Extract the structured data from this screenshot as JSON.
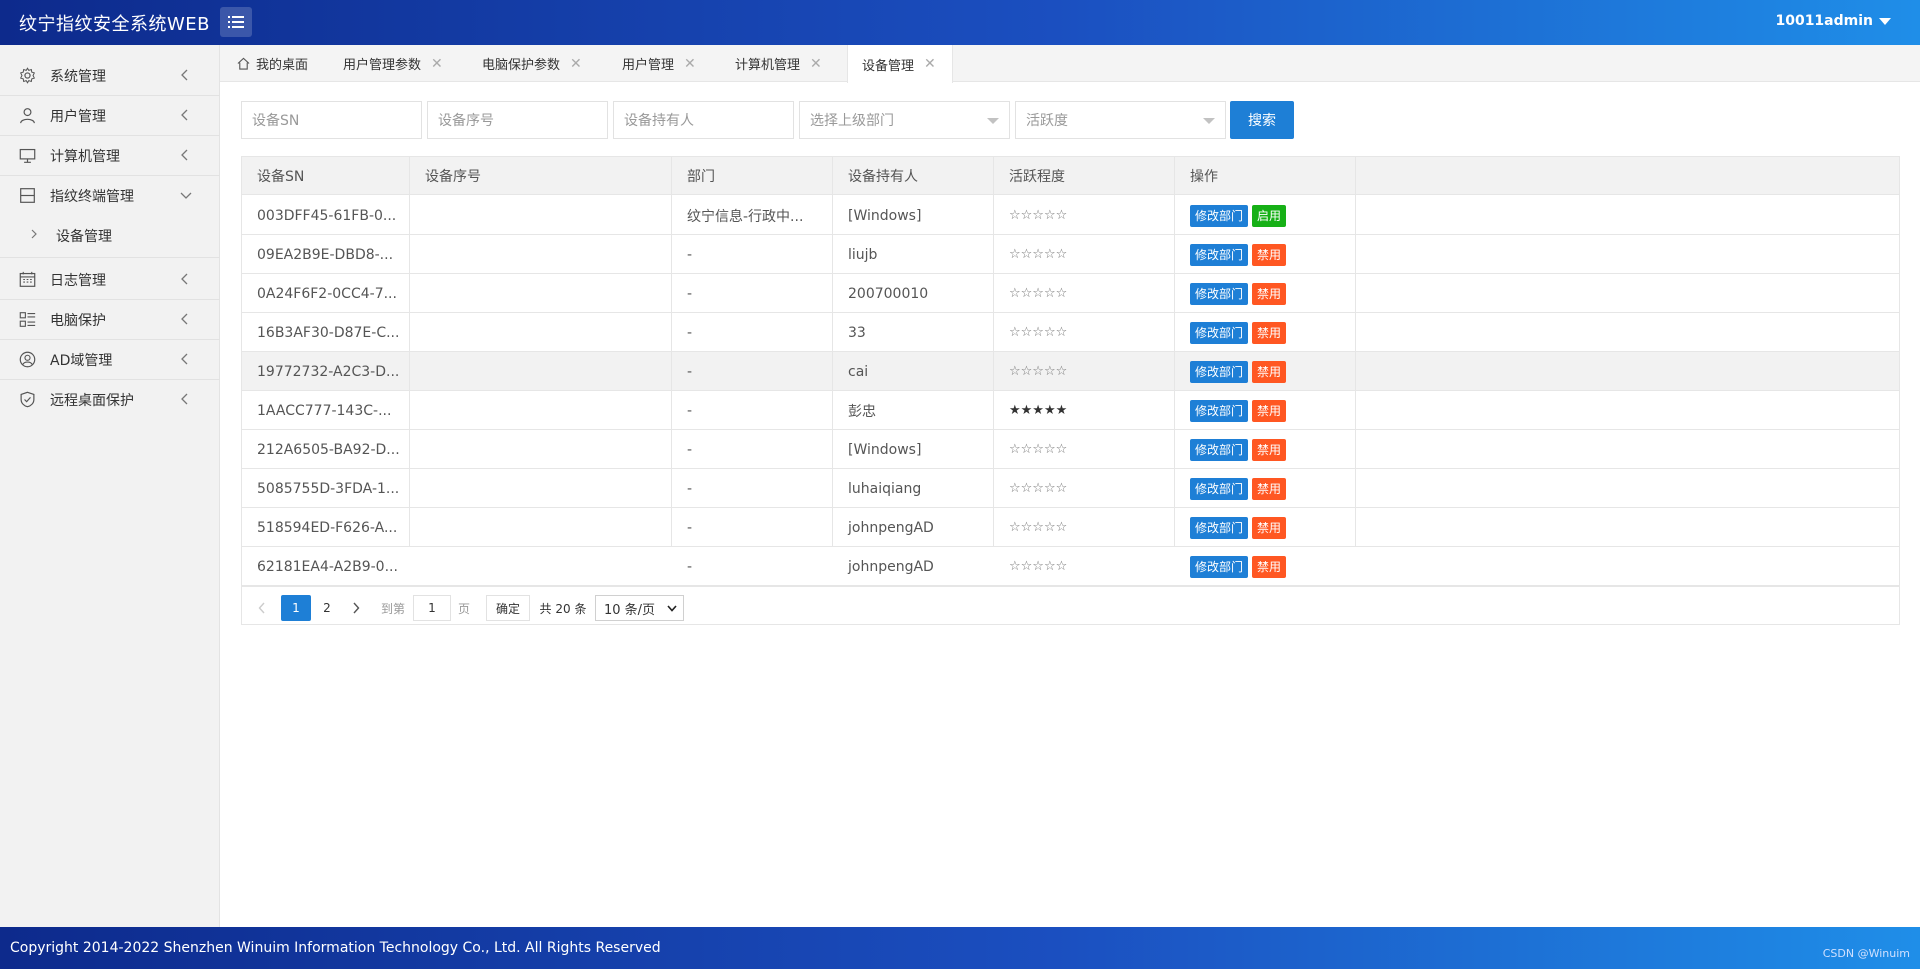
{
  "header": {
    "title": "纹宁指纹安全系统WEB",
    "user": "10011admin"
  },
  "sidebar": {
    "items": [
      {
        "label": "系统管理"
      },
      {
        "label": "用户管理"
      },
      {
        "label": "计算机管理"
      },
      {
        "label": "指纹终端管理"
      },
      {
        "label": "日志管理"
      },
      {
        "label": "电脑保护"
      },
      {
        "label": "AD域管理"
      },
      {
        "label": "远程桌面保护"
      }
    ],
    "sub_items": [
      {
        "label": "设备管理"
      }
    ]
  },
  "tabs": [
    {
      "label": "我的桌面"
    },
    {
      "label": "用户管理参数"
    },
    {
      "label": "电脑保护参数"
    },
    {
      "label": "用户管理"
    },
    {
      "label": "计算机管理"
    },
    {
      "label": "设备管理"
    }
  ],
  "filters": {
    "sn_placeholder": "设备SN",
    "serial_placeholder": "设备序号",
    "owner_placeholder": "设备持有人",
    "dept_placeholder": "选择上级部门",
    "activity_placeholder": "活跃度",
    "search_label": "搜索"
  },
  "table": {
    "columns": [
      "设备SN",
      "设备序号",
      "部门",
      "设备持有人",
      "活跃程度",
      "操作"
    ],
    "rows": [
      {
        "sn": "003DFF45-61FB-0...",
        "serial": "",
        "dept": "纹宁信息-行政中...",
        "owner": "[Windows]",
        "stars": "☆☆☆☆☆",
        "edit": "修改部门",
        "toggle": "启用",
        "toggle_type": "green"
      },
      {
        "sn": "09EA2B9E-DBD8-...",
        "serial": "",
        "dept": "-",
        "owner": "liujb",
        "stars": "☆☆☆☆☆",
        "edit": "修改部门",
        "toggle": "禁用",
        "toggle_type": "orange"
      },
      {
        "sn": "0A24F6F2-0CC4-7...",
        "serial": "",
        "dept": "-",
        "owner": "200700010",
        "stars": "☆☆☆☆☆",
        "edit": "修改部门",
        "toggle": "禁用",
        "toggle_type": "orange"
      },
      {
        "sn": "16B3AF30-D87E-C...",
        "serial": "",
        "dept": "-",
        "owner": "33",
        "stars": "☆☆☆☆☆",
        "edit": "修改部门",
        "toggle": "禁用",
        "toggle_type": "orange"
      },
      {
        "sn": "19772732-A2C3-D...",
        "serial": "",
        "dept": "-",
        "owner": "cai",
        "stars": "☆☆☆☆☆",
        "edit": "修改部门",
        "toggle": "禁用",
        "toggle_type": "orange"
      },
      {
        "sn": "1AACC777-143C-...",
        "serial": "",
        "dept": "-",
        "owner": "彭忠",
        "stars": "★★★★★",
        "edit": "修改部门",
        "toggle": "禁用",
        "toggle_type": "orange"
      },
      {
        "sn": "212A6505-BA92-D...",
        "serial": "",
        "dept": "-",
        "owner": "[Windows]",
        "stars": "☆☆☆☆☆",
        "edit": "修改部门",
        "toggle": "禁用",
        "toggle_type": "orange"
      },
      {
        "sn": "5085755D-3FDA-1...",
        "serial": "",
        "dept": "-",
        "owner": "luhaiqiang",
        "stars": "☆☆☆☆☆",
        "edit": "修改部门",
        "toggle": "禁用",
        "toggle_type": "orange"
      },
      {
        "sn": "518594ED-F626-A...",
        "serial": "",
        "dept": "-",
        "owner": "johnpengAD",
        "stars": "☆☆☆☆☆",
        "edit": "修改部门",
        "toggle": "禁用",
        "toggle_type": "orange"
      },
      {
        "sn": "62181EA4-A2B9-0...",
        "serial": "",
        "dept": "-",
        "owner": "johnpengAD",
        "stars": "☆☆☆☆☆",
        "edit": "修改部门",
        "toggle": "禁用",
        "toggle_type": "orange"
      }
    ]
  },
  "pager": {
    "page1": "1",
    "page2": "2",
    "goto_label": "到第",
    "goto_value": "1",
    "page_suffix": "页",
    "confirm_label": "确定",
    "total_label": "共 20 条",
    "page_size": "10 条/页"
  },
  "footer": {
    "copyright": "Copyright 2014-2022 Shenzhen Winuim Information Technology Co., Ltd. All Rights Reserved",
    "watermark": "CSDN @Winuim"
  },
  "colors": {
    "primary": "#1e7fd6",
    "enable": "#16b016",
    "disable": "#ff5722",
    "header_start": "#0d2a8c",
    "header_end": "#1f8ee8"
  }
}
